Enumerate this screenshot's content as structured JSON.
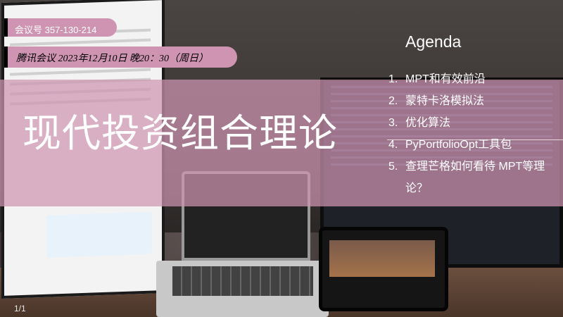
{
  "meeting_id": "会议号 357-130-214",
  "meeting_time": "腾讯会议 2023年12月10日 晚20：30（周日）",
  "title": "现代投资组合理论",
  "agenda": {
    "heading": "Agenda",
    "items": [
      {
        "num": "1.",
        "text": "MPT和有效前沿"
      },
      {
        "num": "2.",
        "text": "蒙特卡洛模拟法"
      },
      {
        "num": "3.",
        "text": "优化算法"
      },
      {
        "num": "4.",
        "text": "PyPortfolioOpt工具包"
      },
      {
        "num": "5.",
        "text": "查理芒格如何看待 MPT等理论？"
      }
    ]
  },
  "page_number": "1/1",
  "colors": {
    "accent_pink": "#ce94b2",
    "band_pink": "rgba(206,148,178,0.72)",
    "text": "#ffffff"
  }
}
